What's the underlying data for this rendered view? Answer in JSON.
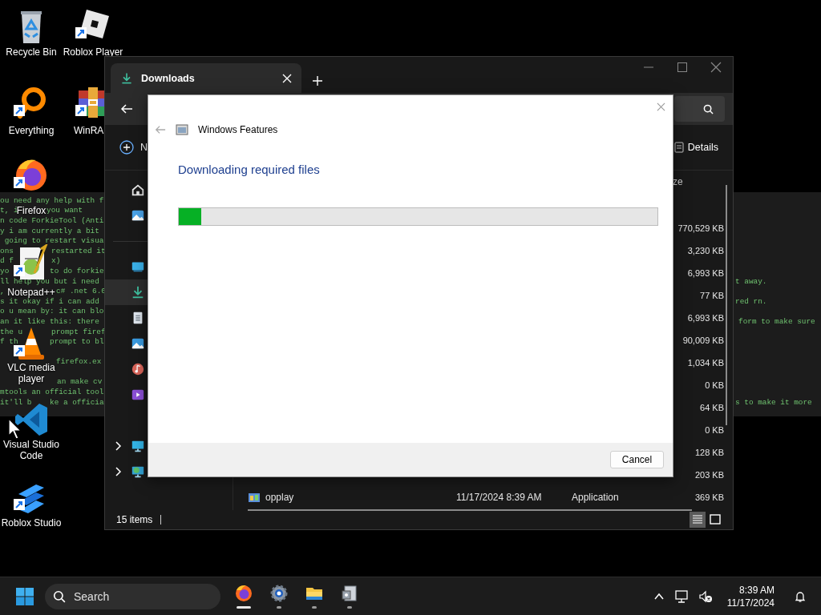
{
  "desktop_icons": [
    {
      "label": "Recycle Bin",
      "shortcut": false
    },
    {
      "label": "Roblox Player",
      "shortcut": true
    },
    {
      "label": "Everything",
      "shortcut": true
    },
    {
      "label": "WinRA",
      "shortcut": true
    },
    {
      "label": "Firefox",
      "shortcut": true
    },
    {
      "label": "Notepad++",
      "shortcut": true
    },
    {
      "label": "VLC media player",
      "shortcut": true
    },
    {
      "label": "Visual Studio Code",
      "shortcut": false
    },
    {
      "label": "Roblox Studio",
      "shortcut": true
    }
  ],
  "terminal": {
    "lines": [
      {
        "segments": [
          "ou need any help with f"
        ]
      },
      {
        "segments": [
          "t, i",
          "you want"
        ]
      },
      {
        "segments": [
          "n code ForkieTool (Anti"
        ]
      },
      {
        "segments": [
          "y i am currently a bit"
        ]
      },
      {
        "segments": [
          " going to restart visua"
        ]
      },
      {
        "segments": [
          "ons",
          "restarted it"
        ]
      },
      {
        "segments": [
          "d f",
          "x)"
        ]
      },
      {
        "segments": [
          "yo",
          "to do forkie"
        ]
      },
      {
        "segments": [
          "ll help you but i need",
          "t away."
        ]
      },
      {
        "segments": [
          ",",
          "c# .net 6.0"
        ]
      },
      {
        "segments": [
          "s it okay if i can add",
          "red rn."
        ]
      },
      {
        "segments": [
          "o u mean by: it can blo"
        ]
      },
      {
        "segments": [
          "an it like this: there",
          "form to make sure"
        ]
      },
      {
        "segments": [
          "the u",
          "prompt firef"
        ]
      },
      {
        "segments": [
          "f th",
          "prompt to bl"
        ]
      },
      {
        "blank": true
      },
      {
        "segments": [
          "firefox.ex"
        ]
      },
      {
        "blank": true
      },
      {
        "segments": [
          "an make cv"
        ]
      },
      {
        "segments": [
          "mtools an official tool"
        ]
      },
      {
        "segments": [
          "it'll b",
          "ke a officia",
          "s to make it more"
        ]
      }
    ]
  },
  "explorer": {
    "tabs": [
      {
        "label": "Downloads",
        "selected": true
      }
    ],
    "new_label": "N",
    "details_label": "Details",
    "sidebar": [
      {
        "selected": false,
        "expandable": false
      },
      {
        "selected": false,
        "expandable": false
      },
      {
        "selected": false,
        "expandable": false
      },
      {
        "selected": true,
        "expandable": false
      },
      {
        "selected": false,
        "expandable": false
      },
      {
        "selected": false,
        "expandable": false
      },
      {
        "selected": false,
        "expandable": false
      },
      {
        "selected": false,
        "expandable": false
      },
      {
        "selected": false,
        "expandable": true
      },
      {
        "selected": false,
        "expandable": true
      }
    ],
    "size_column": "ze",
    "rows": [
      {
        "size": "770,529 KB"
      },
      {
        "size": "3,230 KB"
      },
      {
        "size": "6,993 KB"
      },
      {
        "size": "77 KB"
      },
      {
        "size": "6,993 KB"
      },
      {
        "size": "90,009 KB"
      },
      {
        "size": "1,034 KB"
      },
      {
        "size": "0 KB"
      },
      {
        "size": "64 KB"
      },
      {
        "size": "0 KB"
      },
      {
        "size": "128 KB"
      },
      {
        "size": "203 KB"
      },
      {
        "name": "opplay",
        "date": "11/17/2024 8:39 AM",
        "type": "Application",
        "size": "369 KB"
      }
    ],
    "status": "15 items",
    "views": [
      {
        "selected": true
      },
      {
        "selected": false
      }
    ]
  },
  "dialog": {
    "title": "Windows Features",
    "heading": "Downloading required files",
    "progress": {
      "level": 0.047
    },
    "buttons": [
      "Cancel"
    ]
  },
  "taskbar": {
    "search_placeholder": "Search",
    "apps": [
      {
        "active": true
      },
      {
        "active": false
      },
      {
        "active": false
      },
      {
        "active": false
      }
    ],
    "time": "8:39 AM",
    "date": "11/17/2024"
  }
}
